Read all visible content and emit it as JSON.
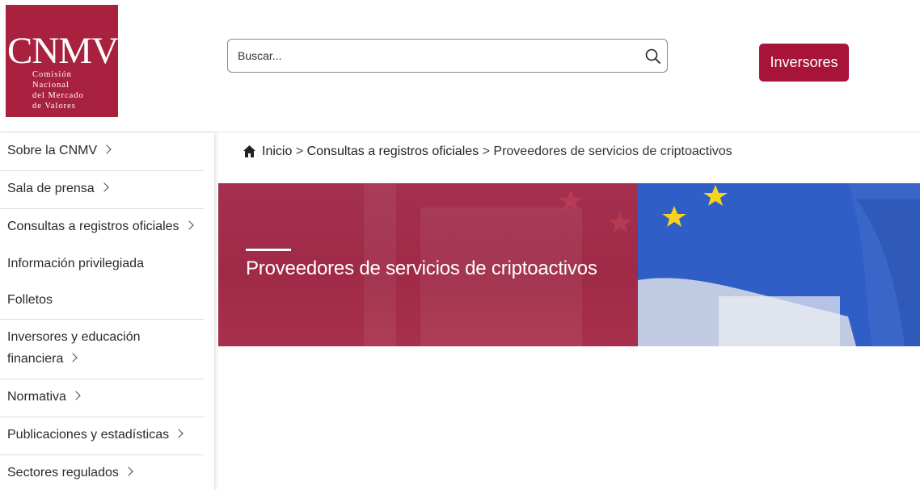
{
  "header": {
    "logo": {
      "mark": "CNMV",
      "lines": [
        "Comisión",
        "Nacional",
        "del Mercado",
        "de Valores"
      ]
    },
    "search": {
      "placeholder": "Buscar..."
    },
    "investors_button": "Inversores"
  },
  "sidebar": {
    "items": [
      {
        "label": "Sobre la CNMV",
        "has_submenu": true
      },
      {
        "label": "Sala de prensa",
        "has_submenu": true
      },
      {
        "label": "Consultas a registros oficiales",
        "has_submenu": true
      },
      {
        "label": "Información privilegiada",
        "has_submenu": false
      },
      {
        "label": "Folletos",
        "has_submenu": false
      },
      {
        "label": "Inversores y educación financiera",
        "line1": "Inversores y educación",
        "line2": "financiera",
        "has_submenu": true
      },
      {
        "label": "Normativa",
        "has_submenu": true
      },
      {
        "label": "Publicaciones y estadísticas",
        "has_submenu": true
      },
      {
        "label": "Sectores regulados",
        "has_submenu": true
      }
    ]
  },
  "breadcrumb": {
    "home": "Inicio",
    "separator": ">",
    "level1": "Consultas a registros oficiales",
    "current": "Proveedores de servicios de criptoactivos"
  },
  "banner": {
    "title": "Proveedores de servicios de criptoactivos"
  },
  "colors": {
    "brand": "#a8223f",
    "button": "#a8133a",
    "banner_overlay": "#a4304f",
    "flag_blue": "#2f5ec6",
    "flag_star": "#f7d21a"
  }
}
